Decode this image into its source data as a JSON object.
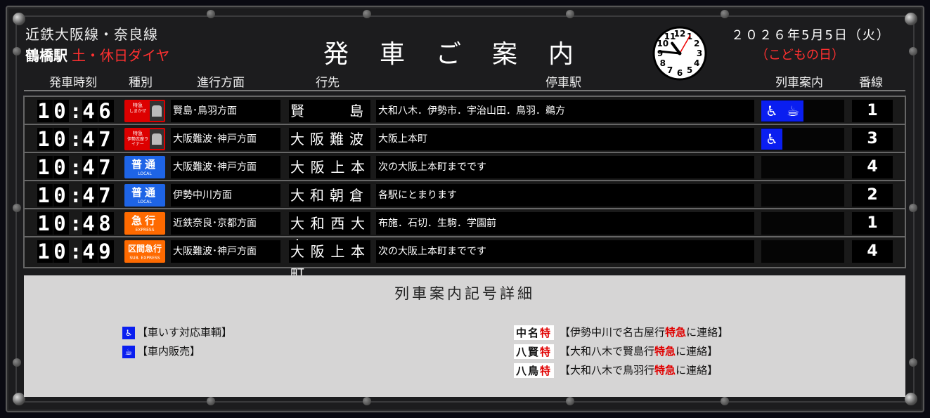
{
  "header": {
    "line": "近鉄大阪線・奈良線",
    "station": "鶴橋駅",
    "diagram": "土・休日ダイヤ",
    "title": "発車ご案内",
    "date": "２０２６年5月5日（火）",
    "holiday": "（こどもの日）"
  },
  "clock": {
    "numbers": [
      "12",
      "1",
      "2",
      "3",
      "4",
      "5",
      "6",
      "7",
      "8",
      "9",
      "10",
      "11"
    ],
    "hour": 10,
    "minute": 46,
    "second": 5
  },
  "columns": {
    "time": "発車時刻",
    "type": "種別",
    "direction": "進行方面",
    "destination": "行先",
    "stops": "停車駅",
    "info": "列車案内",
    "platform": "番線"
  },
  "rows": [
    {
      "time": [
        "1",
        "0",
        "4",
        "6"
      ],
      "type": "特急",
      "type_sub": "しまかぜ",
      "type_kind": "ltd",
      "direction": "賢島･鳥羽方面",
      "destination": "賢　　島",
      "stops": "大和八木．伊勢市．宇治山田．鳥羽．鵜方",
      "icons": [
        "wheelchair-icon",
        "shop-icon"
      ],
      "platform": "1"
    },
    {
      "time": [
        "1",
        "0",
        "4",
        "7"
      ],
      "type": "特急",
      "type_sub": "伊勢志摩ライナー",
      "type_kind": "ltd",
      "direction": "大阪難波･神戸方面",
      "destination": "大阪難波",
      "stops": "大阪上本町",
      "icons": [
        "wheelchair-icon"
      ],
      "platform": "3"
    },
    {
      "time": [
        "1",
        "0",
        "4",
        "7"
      ],
      "type": "普通",
      "type_sub": "LOCAL",
      "type_kind": "local",
      "direction": "大阪難波･神戸方面",
      "destination": "大阪上本町",
      "stops": "次の大阪上本町までです",
      "icons": [],
      "platform": "4"
    },
    {
      "time": [
        "1",
        "0",
        "4",
        "7"
      ],
      "type": "普通",
      "type_sub": "LOCAL",
      "type_kind": "local",
      "direction": "伊勢中川方面",
      "destination": "大和朝倉",
      "stops": "各駅にとまります",
      "icons": [],
      "platform": "2"
    },
    {
      "time": [
        "1",
        "0",
        "4",
        "8"
      ],
      "type": "急行",
      "type_sub": "EXPRESS",
      "type_kind": "express",
      "direction": "近鉄奈良･京都方面",
      "destination": "大和西大寺",
      "stops": "布施．石切．生駒．学園前",
      "icons": [],
      "platform": "1"
    },
    {
      "time": [
        "1",
        "0",
        "4",
        "9"
      ],
      "type": "区間急行",
      "type_sub": "SUB. EXPRESS",
      "type_kind": "subexpress",
      "direction": "大阪難波･神戸方面",
      "destination": "大阪上本町",
      "stops": "次の大阪上本町までです",
      "icons": [],
      "platform": "4"
    }
  ],
  "type_colors": {
    "ltd": "#d00000",
    "local": "#1e64e6",
    "express": "#ff6a00",
    "subexpress": "#ff6a00"
  },
  "legend": {
    "title": "列車案内記号詳細",
    "wheelchair": "【車いす対応車輌】",
    "shop": "【車内販売】",
    "codes": [
      {
        "code_a": "中名",
        "code_b": "特",
        "pre": "【伊勢中川で名古屋行",
        "hl": "特急",
        "post": "に連絡】"
      },
      {
        "code_a": "八賢",
        "code_b": "特",
        "pre": "【大和八木で賢島行",
        "hl": "特急",
        "post": "に連絡】"
      },
      {
        "code_a": "八鳥",
        "code_b": "特",
        "pre": "【大和八木で鳥羽行",
        "hl": "特急",
        "post": "に連絡】"
      }
    ]
  }
}
